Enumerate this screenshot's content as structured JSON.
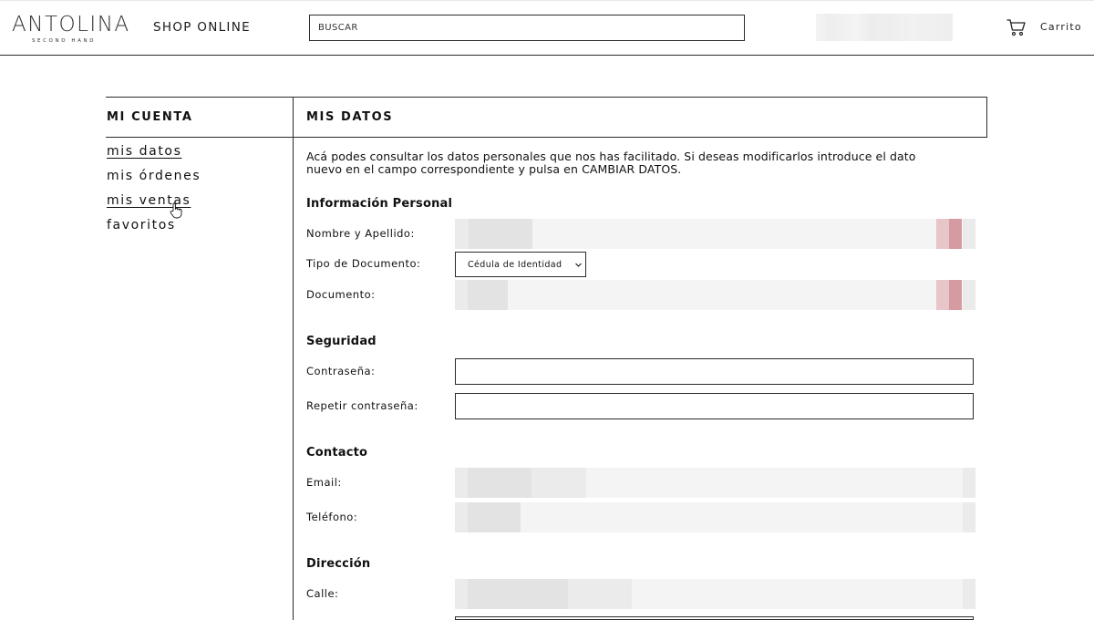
{
  "header": {
    "logo_main": "ANTOLINA",
    "logo_sub": "SECOND HAND",
    "shop_online": "SHOP ONLINE",
    "search_placeholder": "BUSCAR",
    "cart_label": "Carrito"
  },
  "sidebar": {
    "title": "MI CUENTA",
    "items": [
      {
        "label": "mis datos",
        "active": true
      },
      {
        "label": "mis órdenes",
        "active": false
      },
      {
        "label": "mis ventas",
        "active": false,
        "hovered": true
      },
      {
        "label": "favoritos",
        "active": false
      }
    ]
  },
  "main": {
    "title": "MIS DATOS",
    "intro_line1": "Acá podes consultar los datos personales que nos has facilitado. Si deseas modificarlos introduce el dato",
    "intro_line2": "nuevo en el campo correspondiente y pulsa en CAMBIAR DATOS.",
    "sections": {
      "personal": {
        "title": "Información Personal",
        "name_label": "Nombre y Apellido:",
        "doc_type_label": "Tipo de Documento:",
        "doc_type_value": "Cédula de Identidad",
        "doc_label": "Documento:"
      },
      "security": {
        "title": "Seguridad",
        "password_label": "Contraseña:",
        "repeat_password_label": "Repetir contraseña:"
      },
      "contact": {
        "title": "Contacto",
        "email_label": "Email:",
        "phone_label": "Teléfono:"
      },
      "address": {
        "title": "Dirección",
        "street_label": "Calle:"
      }
    }
  },
  "icons": {
    "cart": "cart-icon",
    "select_arrow": "chevron-down-icon",
    "cursor": "hand-pointer-icon"
  },
  "colors": {
    "border": "#2b2b2b",
    "blur_field": "#f4f4f4",
    "redaction_pink": "#d69aa3"
  }
}
